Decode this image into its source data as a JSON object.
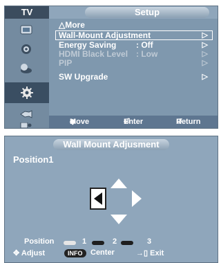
{
  "menu": {
    "sidebar_title": "TV",
    "title": "Setup",
    "sidebar_icons": [
      "picture-icon",
      "sound-icon",
      "channel-icon",
      "setup-icon",
      "input-icon",
      "application-icon"
    ],
    "items": [
      {
        "label": "△More",
        "value": "",
        "arrow": ""
      },
      {
        "label": "Wall-Mount Adjustment",
        "value": "",
        "arrow": "▷"
      },
      {
        "label": "Energy Saving",
        "value": ": Off",
        "arrow": "▷"
      },
      {
        "label": "HDMI Black Level",
        "value": ": Low",
        "arrow": "▷"
      },
      {
        "label": "PIP",
        "value": "",
        "arrow": "▷"
      },
      {
        "label": "SW Upgrade",
        "value": "",
        "arrow": "▷"
      }
    ],
    "footer": {
      "move": "Move",
      "enter": "Enter",
      "return": "Return"
    }
  },
  "dialog": {
    "title": "Wall Mount Adjusment",
    "position_label": "Position1",
    "position_text": "Position",
    "positions": [
      "1",
      "2",
      "3"
    ],
    "adjust": "Adjust",
    "info": "INFO",
    "center": "Center",
    "exit": "Exit"
  }
}
